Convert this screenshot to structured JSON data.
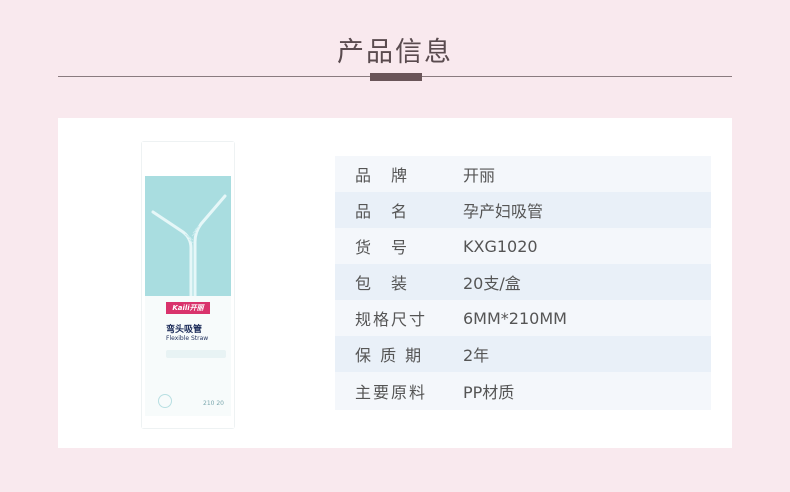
{
  "header": {
    "title": "产品信息"
  },
  "product_image": {
    "brand_label": "Kaili开丽",
    "name_cn": "弯头吸管",
    "name_en": "Flexible Straw",
    "size_text": "210  20"
  },
  "specs": [
    {
      "label": "品　牌",
      "value": "开丽"
    },
    {
      "label": "品　名",
      "value": "孕产妇吸管"
    },
    {
      "label": "货　号",
      "value": "KXG1020"
    },
    {
      "label": "包　装",
      "value": "20支/盒"
    },
    {
      "label": "规格尺寸",
      "value": "6MM*210MM"
    },
    {
      "label": "保 质 期",
      "value": "2年"
    },
    {
      "label": "主要原料",
      "value": "PP材质"
    }
  ],
  "colors": {
    "page_bg": "#f9e9ee",
    "accent": "#6a5559",
    "package_blue": "#a9dde0",
    "brand_pink": "#d9336c"
  }
}
